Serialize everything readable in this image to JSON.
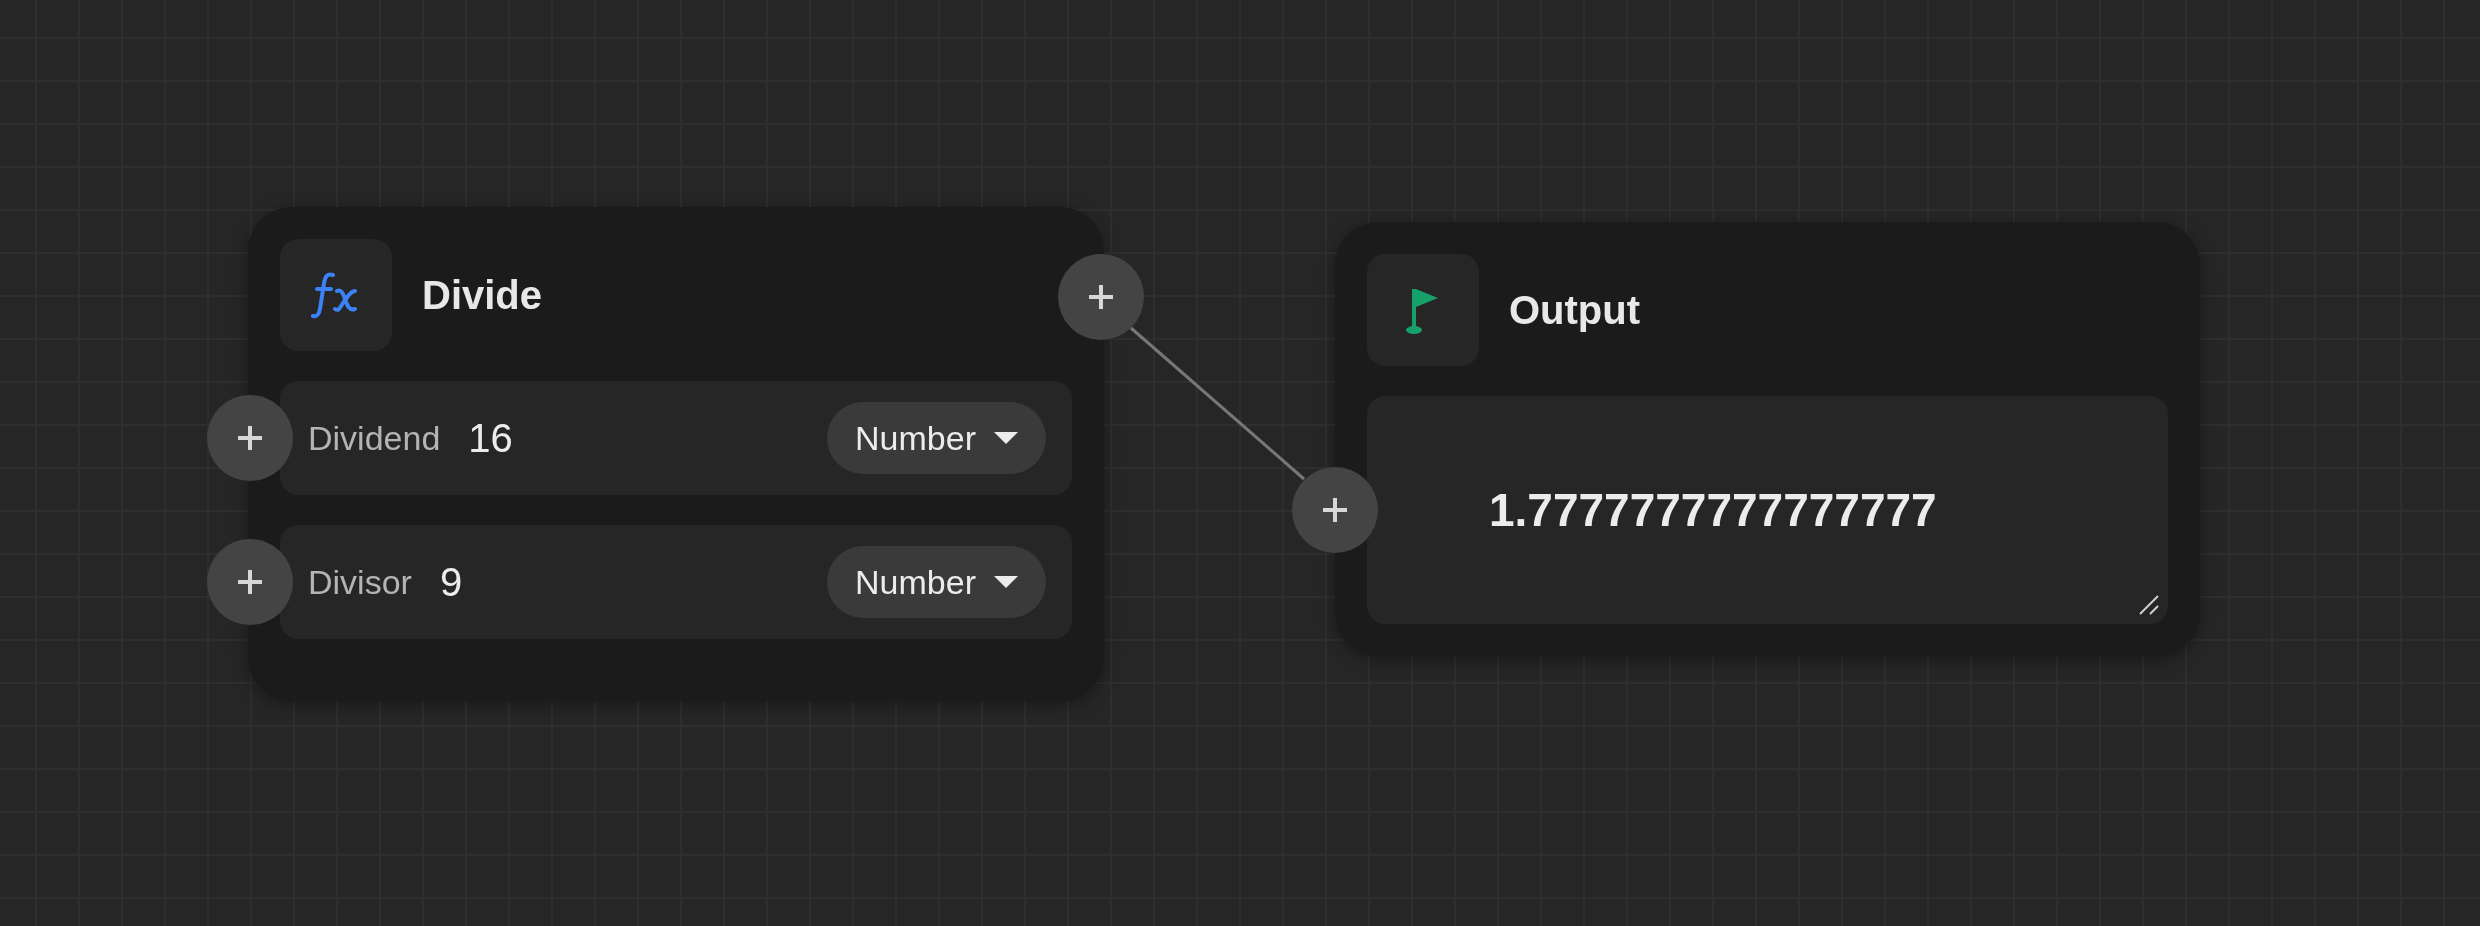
{
  "nodes": [
    {
      "kind": "function",
      "title": "Divide",
      "inputs": [
        {
          "label": "Dividend",
          "value": "16",
          "type": "Number"
        },
        {
          "label": "Divisor",
          "value": "9",
          "type": "Number"
        }
      ]
    },
    {
      "kind": "output",
      "title": "Output",
      "connected": true,
      "value": "1.7777777777777777"
    }
  ]
}
